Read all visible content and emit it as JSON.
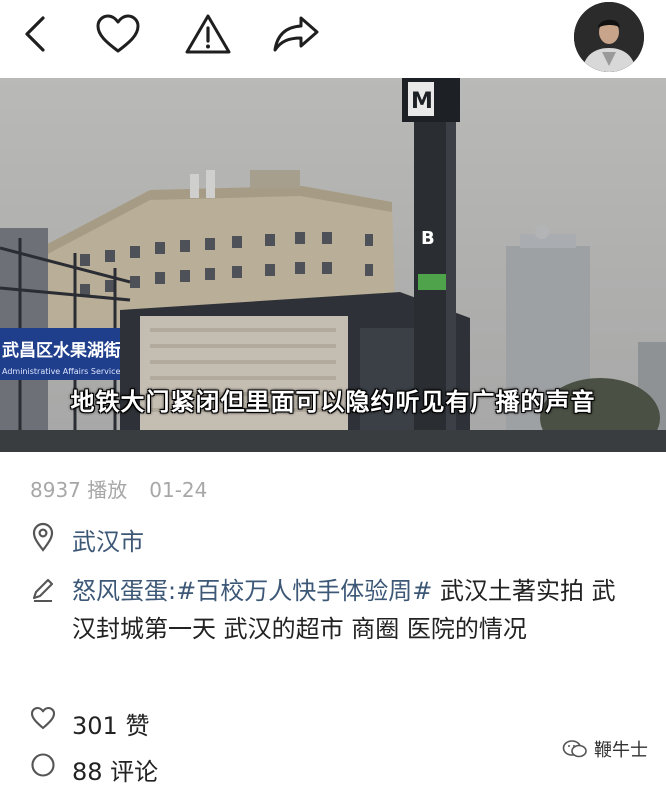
{
  "header": {
    "back_icon": "chevron-left-icon",
    "like_icon": "heart-icon",
    "report_icon": "warning-icon",
    "share_icon": "share-arrow-icon"
  },
  "video": {
    "caption": "地铁大门紧闭但里面可以隐约听见有广播的声音",
    "station_sign": "M",
    "exit_label": "B",
    "street_sign": "武昌区水果湖街",
    "street_sign_en": "Administrative Affairs Service Center"
  },
  "stats": {
    "plays": "8937 播放",
    "date": "01-24"
  },
  "location": {
    "text": "武汉市"
  },
  "description": {
    "author": "怒风蛋蛋:",
    "tag": "#百校万人快手体验周#",
    "text": " 武汉土著实拍 武汉封城第一天 武汉的超市 商圈 医院的情况"
  },
  "likes": {
    "text": "301 赞"
  },
  "comments": {
    "text": "88 评论"
  },
  "watermark": {
    "text": "鞭牛士"
  },
  "colors": {
    "link": "#3d5877",
    "meta": "#a7a7a7",
    "icon": "#1f1f1f"
  }
}
